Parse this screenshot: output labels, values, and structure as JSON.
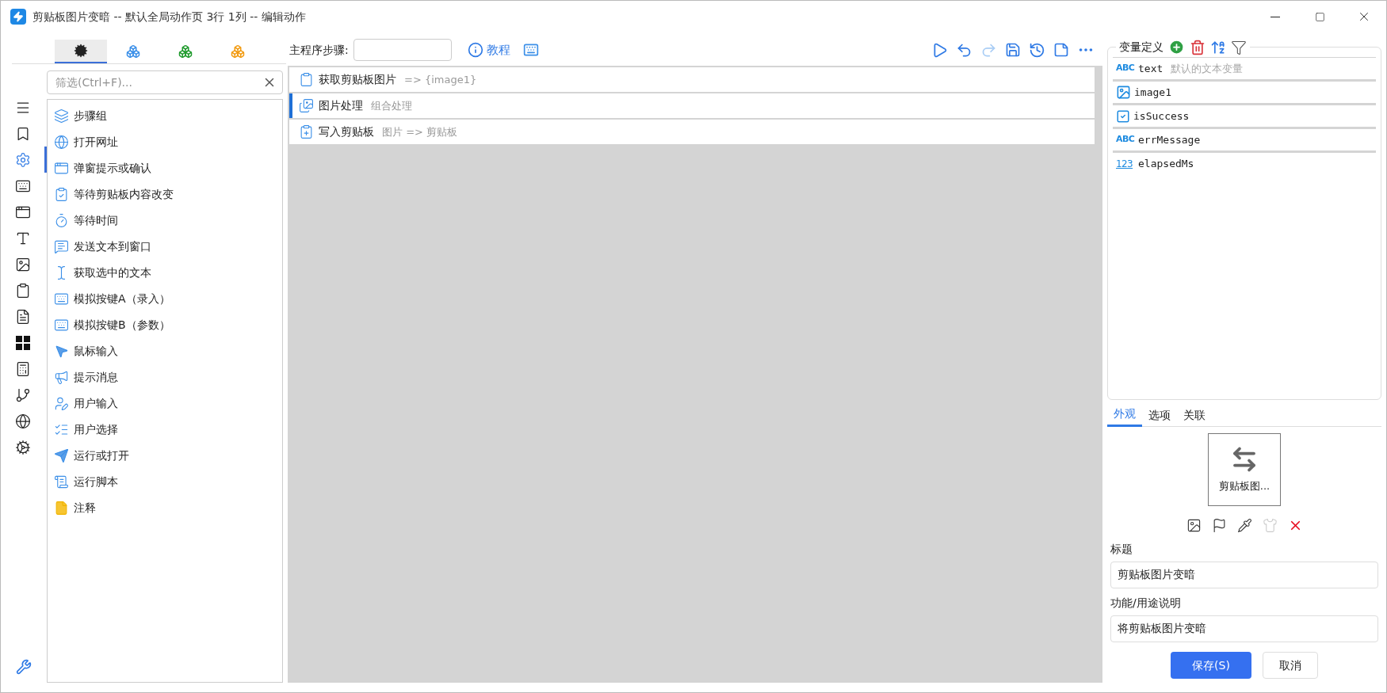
{
  "window": {
    "title": "剪贴板图片变暗 -- 默认全局动作页 3行 1列 -- 编辑动作"
  },
  "panel_tabs": [
    {
      "selected": true
    },
    {
      "selected": false
    },
    {
      "selected": false
    },
    {
      "selected": false
    }
  ],
  "rail": [
    {
      "selected": false
    },
    {
      "selected": false
    },
    {
      "selected": true
    },
    {
      "selected": false
    },
    {
      "selected": false
    },
    {
      "selected": false
    },
    {
      "selected": false
    },
    {
      "selected": false
    },
    {
      "selected": false
    },
    {
      "selected": false
    },
    {
      "selected": false
    },
    {
      "selected": false
    },
    {
      "selected": false
    },
    {
      "selected": false
    }
  ],
  "filter": {
    "placeholder": "筛选(Ctrl+F)..."
  },
  "actions": [
    {
      "label": "步骤组"
    },
    {
      "label": "打开网址"
    },
    {
      "label": "弹窗提示或确认"
    },
    {
      "label": "等待剪贴板内容改变"
    },
    {
      "label": "等待时间"
    },
    {
      "label": "发送文本到窗口"
    },
    {
      "label": "获取选中的文本"
    },
    {
      "label": "模拟按键A（录入）"
    },
    {
      "label": "模拟按键B（参数）"
    },
    {
      "label": "鼠标输入"
    },
    {
      "label": "提示消息"
    },
    {
      "label": "用户输入"
    },
    {
      "label": "用户选择"
    },
    {
      "label": "运行或打开"
    },
    {
      "label": "运行脚本"
    },
    {
      "label": "注释"
    }
  ],
  "toolbar": {
    "steps_label": "主程序步骤:",
    "tutorial": "教程"
  },
  "steps": [
    {
      "title": "获取剪贴板图片",
      "detail": "=> {image1}",
      "selected": false
    },
    {
      "title": "图片处理",
      "detail": "组合处理",
      "selected": true
    },
    {
      "title": "写入剪贴板",
      "detail": "图片 => 剪贴板",
      "selected": false
    }
  ],
  "variables": {
    "title": "变量定义",
    "items": [
      {
        "kind": "text",
        "badge": "ABC",
        "name": "text",
        "note": "默认的文本变量"
      },
      {
        "kind": "image",
        "name": "image1"
      },
      {
        "kind": "bool",
        "name": "isSuccess"
      },
      {
        "kind": "text",
        "badge": "ABC",
        "name": "errMessage"
      },
      {
        "kind": "number",
        "badge": "123",
        "name": "elapsedMs"
      }
    ]
  },
  "props_tabs": [
    {
      "label": "外观",
      "selected": true
    },
    {
      "label": "选项",
      "selected": false
    },
    {
      "label": "关联",
      "selected": false
    }
  ],
  "preview": {
    "caption": "剪贴板图..."
  },
  "fields": [
    {
      "label": "标题",
      "value": "剪贴板图片变暗"
    },
    {
      "label": "功能/用途说明",
      "value": "将剪贴板图片变暗"
    }
  ],
  "buttons": {
    "save": "保存(S)",
    "cancel": "取消"
  }
}
